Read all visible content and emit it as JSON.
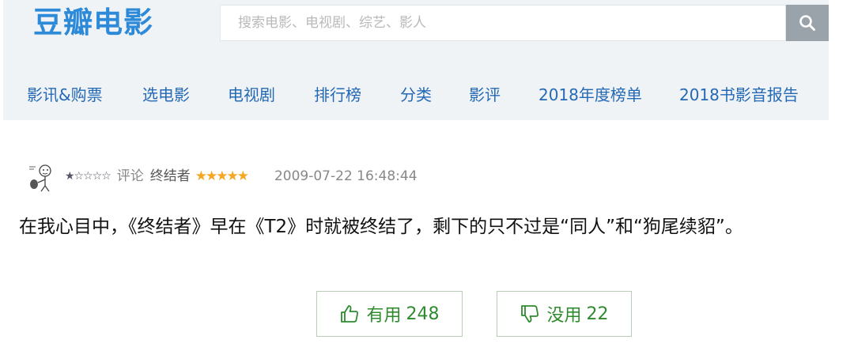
{
  "header": {
    "logo": "豆瓣电影",
    "search": {
      "placeholder": "搜索电影、电视剧、综艺、影人",
      "value": ""
    },
    "search_icon": "search-icon",
    "nav": [
      {
        "label": "影讯&购票"
      },
      {
        "label": "选电影"
      },
      {
        "label": "电视剧"
      },
      {
        "label": "排行榜"
      },
      {
        "label": "分类"
      },
      {
        "label": "影评"
      },
      {
        "label": "2018年度榜单"
      },
      {
        "label": "2018书影音报告"
      }
    ]
  },
  "review": {
    "user_stars": "★☆☆☆☆",
    "label": "评论",
    "movie": "终结者",
    "rating_stars": "★★★★★",
    "timestamp": "2009-07-22 16:48:44",
    "content": "在我心目中，《终结者》早在《T2》时就被终结了，剩下的只不过是“同人”和“狗尾续貂”。",
    "useful": {
      "label": "有用",
      "count": "248",
      "icon": "thumbs-up-icon"
    },
    "useless": {
      "label": "没用",
      "count": "22",
      "icon": "thumbs-down-icon"
    }
  },
  "colors": {
    "brand": "#2d8ad9",
    "nav_link": "#2469b5",
    "header_bg": "#f0f3f5",
    "star": "#f5a623",
    "vote_green": "#2e8b2e"
  }
}
